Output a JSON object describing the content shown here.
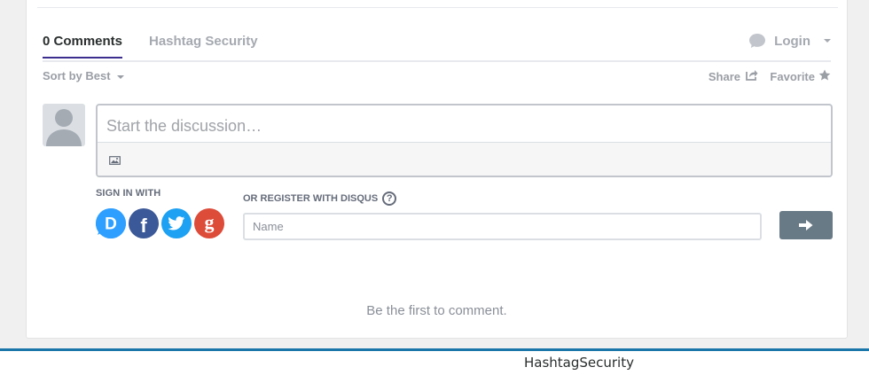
{
  "nav": {
    "comments_tab": "0 Comments",
    "site_tab": "Hashtag Security",
    "login_label": "Login"
  },
  "toolbar": {
    "sort_label": "Sort by Best",
    "share_label": "Share",
    "favorite_label": "Favorite"
  },
  "composer": {
    "placeholder": "Start the discussion…"
  },
  "signin": {
    "label": "SIGN IN WITH",
    "providers": [
      "disqus",
      "facebook",
      "twitter",
      "google"
    ],
    "provider_glyphs": [
      "D",
      "f",
      "t",
      "g"
    ]
  },
  "register": {
    "label": "OR REGISTER WITH DISQUS",
    "help_glyph": "?",
    "name_placeholder": "Name"
  },
  "empty_state": "Be the first to comment.",
  "footer": {
    "text": "HashtagSecurity"
  },
  "colors": {
    "disqus": "#2e9fff",
    "facebook": "#3b5998",
    "twitter": "#1da1f2",
    "google": "#dd4b39",
    "submit": "#687a86",
    "active_tab_underline": "#3b2e8f",
    "footer_rule": "#1a75a8"
  },
  "icons": {
    "login": "speech-bubble-icon",
    "share": "share-arrow-icon",
    "favorite": "star-icon",
    "image": "image-icon",
    "submit": "arrow-right-icon",
    "help": "help-circle-icon"
  }
}
